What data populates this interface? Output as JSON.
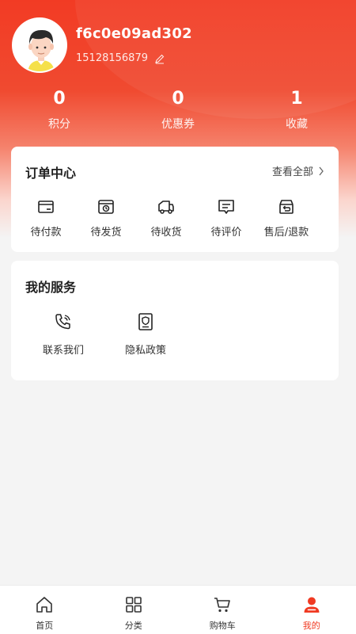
{
  "profile": {
    "username": "f6c0e09ad302",
    "phone": "15128156879"
  },
  "stats": [
    {
      "value": "0",
      "label": "积分"
    },
    {
      "value": "0",
      "label": "优惠券"
    },
    {
      "value": "1",
      "label": "收藏"
    }
  ],
  "orders": {
    "title": "订单中心",
    "view_all": "查看全部",
    "items": [
      {
        "label": "待付款",
        "icon": "wallet-icon"
      },
      {
        "label": "待发货",
        "icon": "package-icon"
      },
      {
        "label": "待收货",
        "icon": "truck-icon"
      },
      {
        "label": "待评价",
        "icon": "comment-icon"
      },
      {
        "label": "售后/退款",
        "icon": "return-box-icon"
      }
    ]
  },
  "services": {
    "title": "我的服务",
    "items": [
      {
        "label": "联系我们",
        "icon": "phone-call-icon"
      },
      {
        "label": "隐私政策",
        "icon": "privacy-doc-icon"
      }
    ]
  },
  "tabbar": {
    "items": [
      {
        "label": "首页",
        "icon": "home-icon"
      },
      {
        "label": "分类",
        "icon": "category-grid-icon"
      },
      {
        "label": "购物车",
        "icon": "cart-icon"
      },
      {
        "label": "我的",
        "icon": "user-icon",
        "active": true
      }
    ]
  },
  "colors": {
    "brand": "#f03a22",
    "text": "#333333"
  }
}
